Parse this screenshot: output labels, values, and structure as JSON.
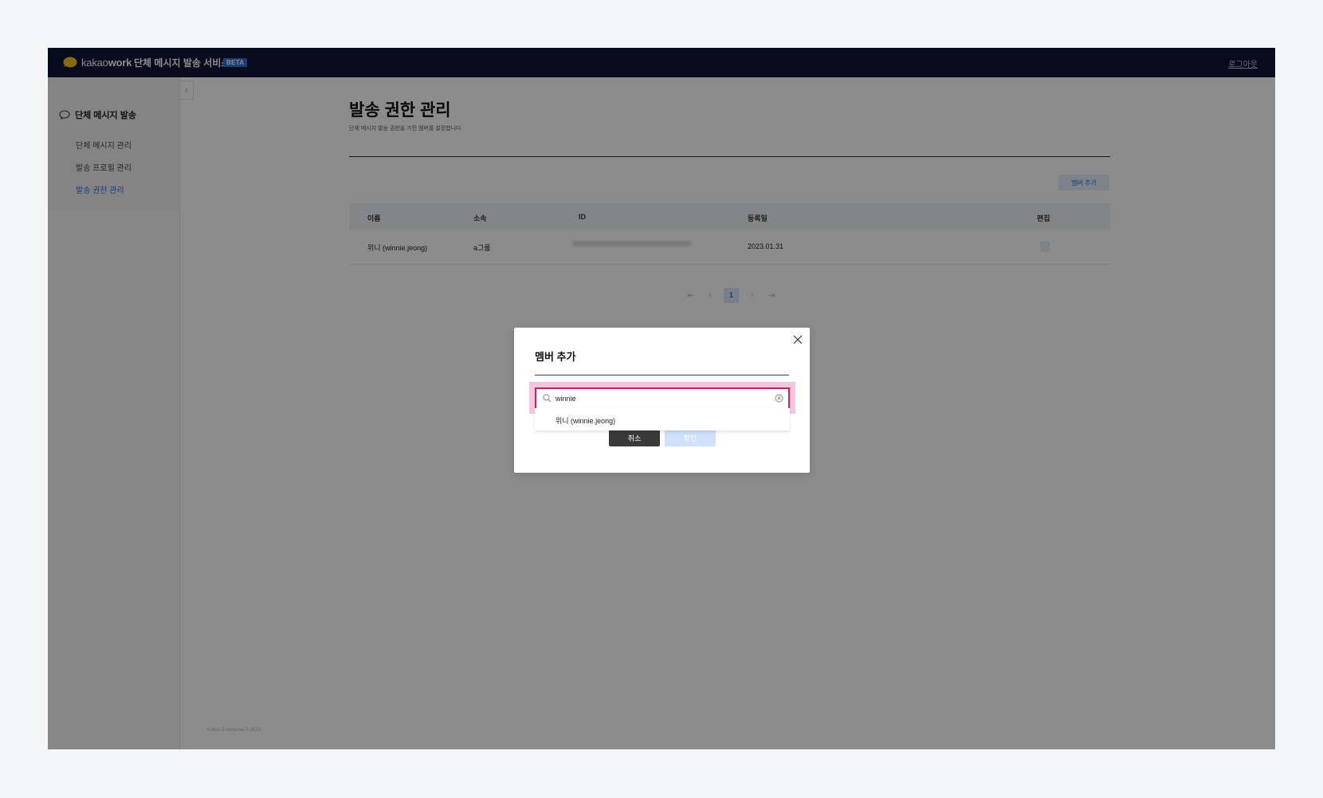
{
  "header": {
    "brand_light": "kakao",
    "brand_bold": "work",
    "service_title": "단체 메시지 발송 서비스",
    "beta_badge": "BETA",
    "logout": "로그아웃"
  },
  "sidebar": {
    "collapse": "‹",
    "section_title": "단체 메시지 발송",
    "items": [
      {
        "label": "단체 메시지 관리",
        "active": false
      },
      {
        "label": "발송 프로필 관리",
        "active": false
      },
      {
        "label": "발송 권한 관리",
        "active": true
      }
    ]
  },
  "main": {
    "title": "발송 권한 관리",
    "description": "단체 메시지 발송 권한을 가진 멤버를 설정합니다.",
    "add_member_button": "멤버 추가",
    "table": {
      "headers": [
        "이름",
        "소속",
        "ID",
        "등록일",
        "편집"
      ],
      "rows": [
        {
          "name": "위니 (winnie.jeong)",
          "org": "a그룹",
          "registered": "2023.01.31"
        }
      ]
    },
    "pagination": {
      "current": "1"
    },
    "footer": "Kakao Enterprise © 2023"
  },
  "modal": {
    "title": "멤버 추가",
    "search_value": "winnie",
    "suggestion": "위니 (winnie.jeong)",
    "cancel": "취소",
    "confirm": "확인"
  },
  "colors": {
    "topbar": "#0b1437",
    "accent": "#2f6fd6",
    "search_highlight": "#d81b60"
  }
}
